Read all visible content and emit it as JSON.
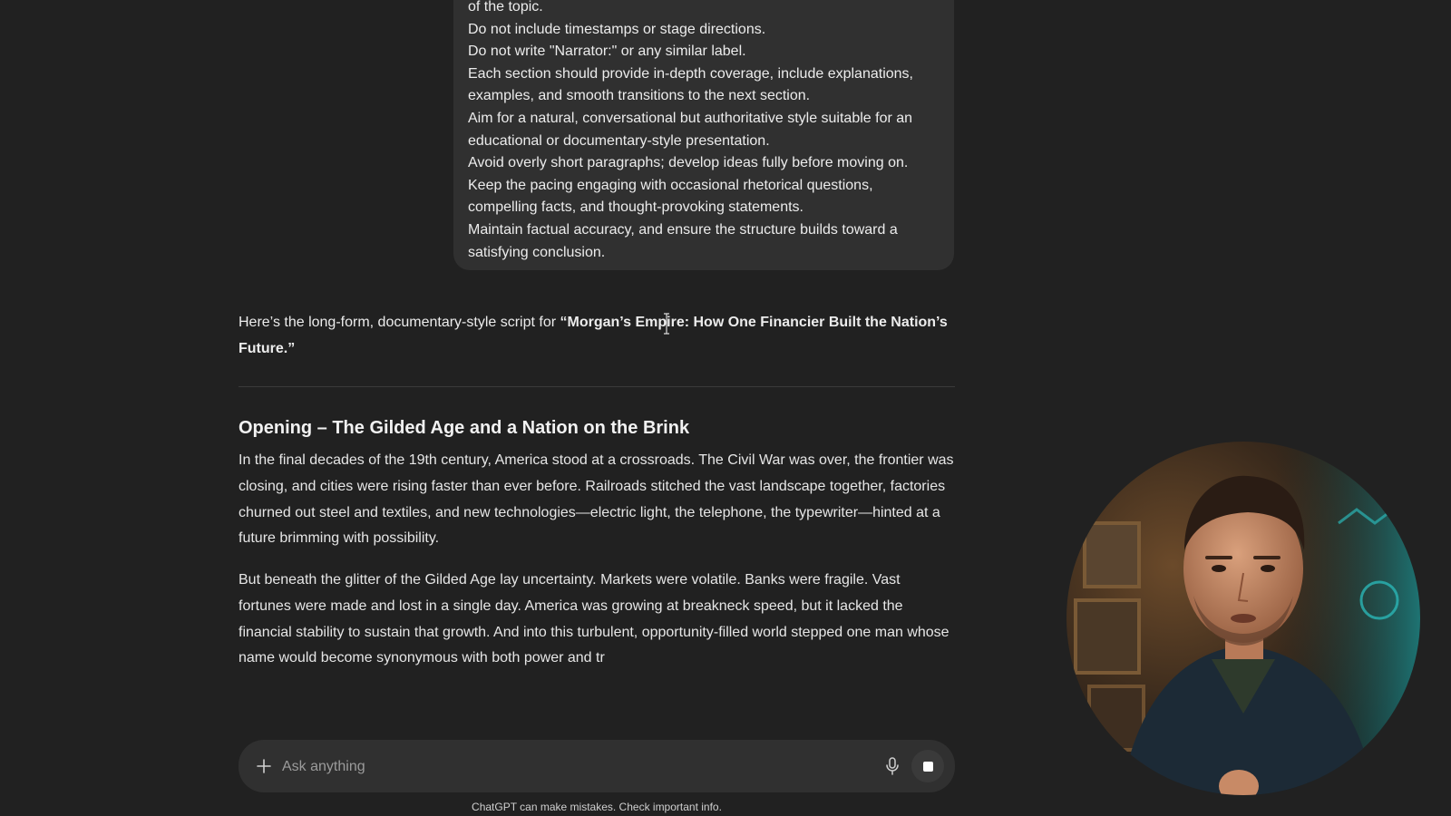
{
  "user_message": {
    "lines": [
      "of the topic.",
      "Do not include timestamps or stage directions.",
      "Do not write \"Narrator:\" or any similar label.",
      "Each section should provide in-depth coverage, include explanations,",
      "examples, and smooth transitions to the next section.",
      "Aim for a natural, conversational but authoritative style suitable for an",
      "educational or documentary-style presentation.",
      "Avoid overly short paragraphs; develop ideas fully before moving on.",
      "Keep the pacing engaging with occasional rhetorical questions,",
      "compelling facts, and thought-provoking statements.",
      "Maintain factual accuracy, and ensure the structure builds toward a",
      "satisfying conclusion."
    ]
  },
  "assistant": {
    "intro_prefix": "Here’s the long-form, documentary-style script for ",
    "intro_title": "“Morgan’s Empire: How One Financier Built the Nation’s Future.”",
    "heading": "Opening – The Gilded Age and a Nation on the Brink",
    "paragraph_1": "In the final decades of the 19th century, America stood at a crossroads. The Civil War was over, the frontier was closing, and cities were rising faster than ever before. Railroads stitched the vast landscape together, factories churned out steel and textiles, and new technologies—electric light, the telephone, the typewriter—hinted at a future brimming with possibility.",
    "paragraph_2": "But beneath the glitter of the Gilded Age lay uncertainty. Markets were volatile. Banks were fragile. Vast fortunes were made and lost in a single day. America was growing at breakneck speed, but it lacked the financial stability to sustain that growth. And into this turbulent, opportunity-filled world stepped one man whose name would become synonymous with both power and tr"
  },
  "composer": {
    "placeholder": "Ask anything",
    "plus_icon": "plus-icon",
    "mic_icon": "microphone-icon",
    "stop_icon": "stop-icon"
  },
  "disclaimer": "ChatGPT can make mistakes. Check important info.",
  "colors": {
    "background": "#212121",
    "bubble": "#303030",
    "composer": "#303030",
    "text": "#ececec"
  }
}
